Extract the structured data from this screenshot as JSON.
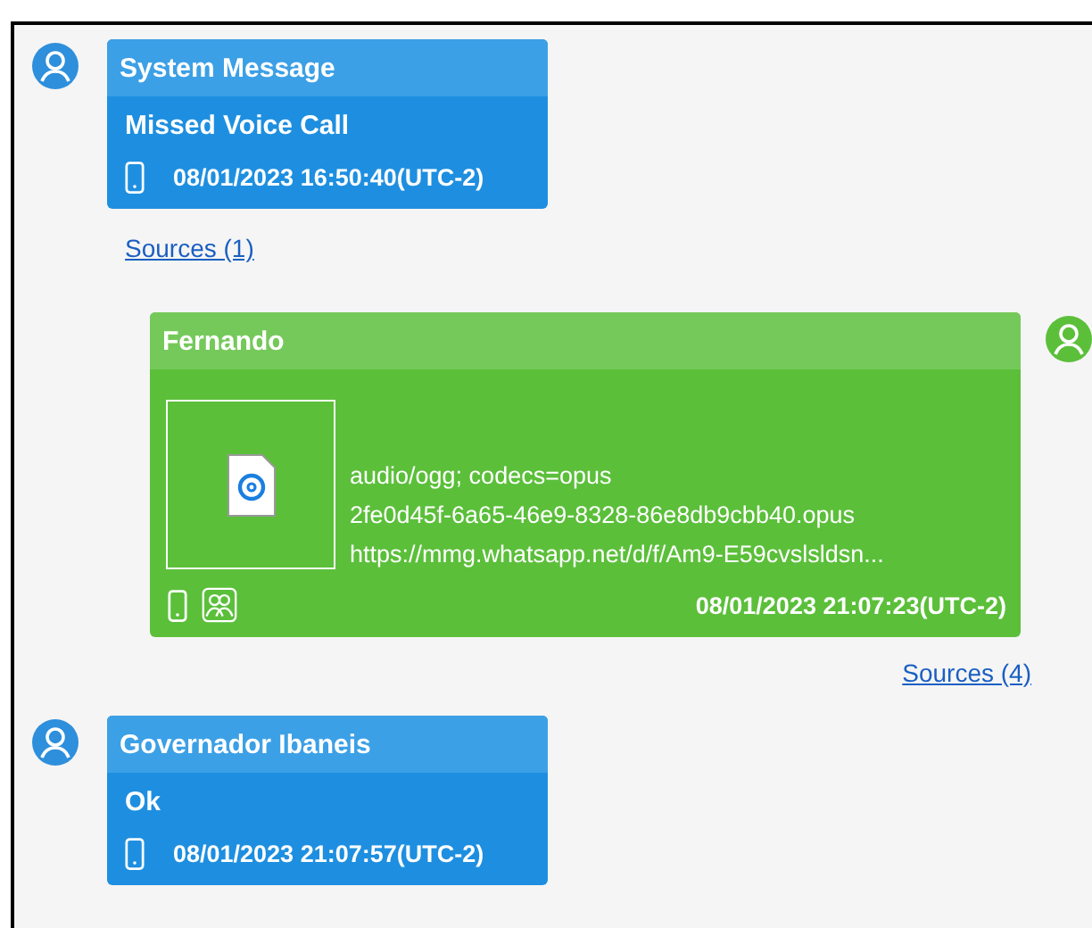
{
  "messages": [
    {
      "kind": "incoming",
      "sender": "System Message",
      "body": "Missed Voice Call",
      "timestamp": "08/01/2023 16:50:40(UTC-2)",
      "sources": "Sources (1)"
    },
    {
      "kind": "outgoing",
      "sender": "Fernando",
      "attachment_lines": [
        "audio/ogg; codecs=opus",
        "2fe0d45f-6a65-46e9-8328-86e8db9cbb40.opus",
        "https://mmg.whatsapp.net/d/f/Am9-E59cvslsldsn..."
      ],
      "timestamp": "08/01/2023 21:07:23(UTC-2)",
      "sources": "Sources (4)"
    },
    {
      "kind": "incoming",
      "sender": "Governador Ibaneis",
      "body": "Ok",
      "timestamp": "08/01/2023 21:07:57(UTC-2)"
    }
  ]
}
